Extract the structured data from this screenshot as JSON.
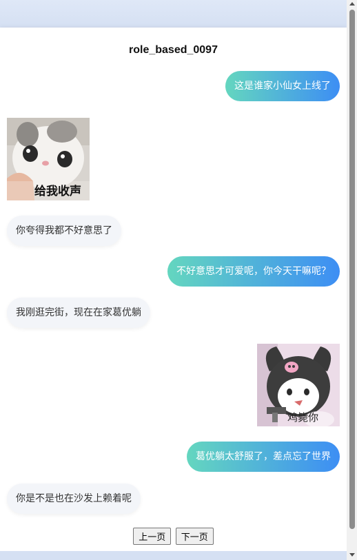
{
  "chat": {
    "title": "role_based_0097",
    "messages": [
      {
        "side": "right",
        "type": "text",
        "text": "这是谁家小仙女上线了"
      },
      {
        "side": "left",
        "type": "sticker",
        "sticker": "cat-sticker",
        "caption": "给我收声"
      },
      {
        "side": "left",
        "type": "text",
        "text": "你夸得我都不好意思了"
      },
      {
        "side": "right",
        "type": "text",
        "text": "不好意思才可爱呢，你今天干嘛呢？"
      },
      {
        "side": "left",
        "type": "text",
        "text": "我刚逛完街，现在在家葛优躺"
      },
      {
        "side": "right",
        "type": "sticker",
        "sticker": "kuromi-sticker",
        "caption": "鸡毙你"
      },
      {
        "side": "right",
        "type": "text",
        "text": "葛优躺太舒服了，差点忘了世界"
      },
      {
        "side": "left",
        "type": "text",
        "text": "你是不是也在沙发上赖着呢"
      }
    ]
  },
  "pager": {
    "prev_label": "上一页",
    "next_label": "下一页"
  },
  "colors": {
    "bubble_gradient_start": "#64d6bf",
    "bubble_gradient_end": "#3d8ef4",
    "left_bubble_bg": "#f3f5f9"
  }
}
